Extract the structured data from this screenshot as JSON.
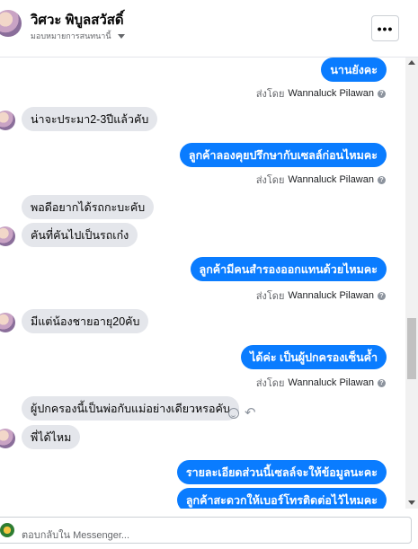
{
  "header": {
    "name": "วิศวะ พิบูลสวัสดิ์",
    "subtitle": "มอบหมายการสนทนานี้",
    "more_label": "•••"
  },
  "sent_meta": {
    "prefix": "ส่งโดย",
    "sender": "Wannaluck Pilawan",
    "help": "?"
  },
  "messages": [
    {
      "dir": "out",
      "text": "นานยังคะ"
    },
    {
      "dir": "in",
      "text": "น่าจะประมา2-3ปีแล้วคับ"
    },
    {
      "dir": "out",
      "text": "ลูกค้าลองคุยปรึกษากับเซลล์ก่อนไหมคะ"
    },
    {
      "dir": "in",
      "text": "พอดีอยากได้รถกะบะคับ"
    },
    {
      "dir": "in",
      "text": "คันที่คันไปเป็นรถเก๋ง"
    },
    {
      "dir": "out",
      "text": "ลูกค้ามีคนสำรองออกแทนด้วยไหมคะ"
    },
    {
      "dir": "in",
      "text": "มีแต่น้องชายอายุ20คับ"
    },
    {
      "dir": "out",
      "text": "ได้ค่ะ  เป็นผู้ปกครองเซ็นค้ำ"
    },
    {
      "dir": "in",
      "text": "ผู้ปกครองนี้เป็นพ่อกับแม่อย่างเดียวหรอคับ"
    },
    {
      "dir": "in",
      "text": "พี่ได้ไหม"
    },
    {
      "dir": "out",
      "text": "รายละเอียดส่วนนี้เซลล์จะให้ข้อมูลนะคะ"
    },
    {
      "dir": "out",
      "text": "ลูกค้าสะดวกให้เบอร์โทรติดต่อไว้ไหมคะ"
    }
  ],
  "composer": {
    "placeholder": "ตอบกลับใน Messenger..."
  },
  "colors": {
    "outgoing_bubble": "#0a7cff",
    "incoming_bubble": "#e4e6eb"
  }
}
